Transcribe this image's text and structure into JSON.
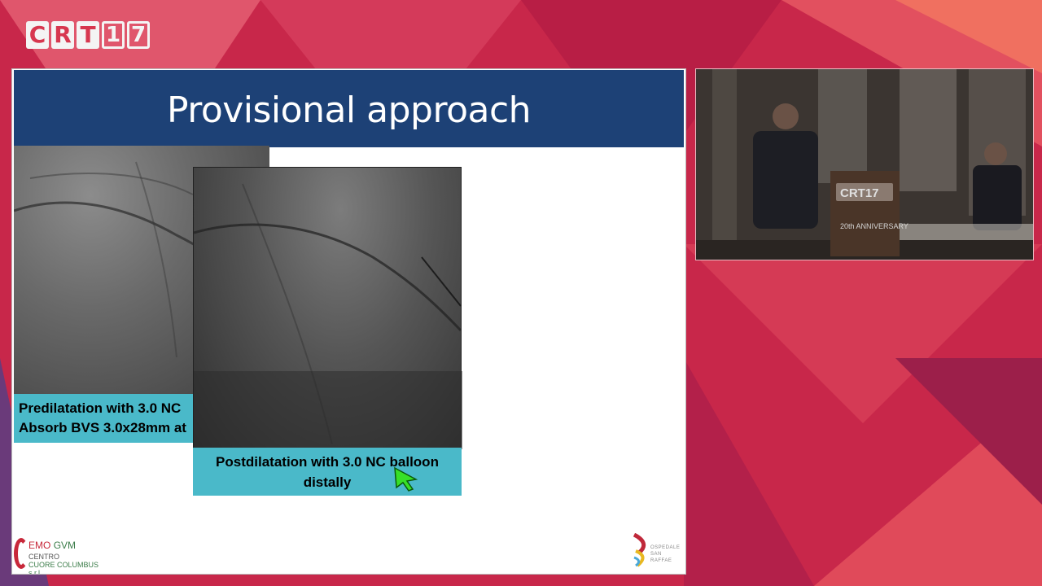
{
  "header": {
    "logo_letters": [
      "C",
      "R",
      "T",
      "1",
      "7"
    ]
  },
  "slide": {
    "title": "Provisional approach",
    "caption_left_line1": "Predilatation with 3.0 NC",
    "caption_left_line2": "Absorb BVS 3.0x28mm at",
    "caption_right_line1": "Postdilatation with 3.0 NC balloon",
    "caption_right_line2": "distally",
    "footer_left": {
      "line1a": "EMO",
      "line1b": "GVM",
      "line2": "CENTRO",
      "line3": "CUORE COLUMBUS s.r.l."
    },
    "footer_right": {
      "line1": "OSPEDALE",
      "line2": "SAN RAFFAE"
    }
  },
  "video": {
    "podium_logo": "CRT17",
    "podium_sub": "20th ANNIVERSARY"
  },
  "colors": {
    "title_bar": "#1d4176",
    "caption_bg": "#4ab9c9",
    "brand_red": "#d7374f"
  }
}
